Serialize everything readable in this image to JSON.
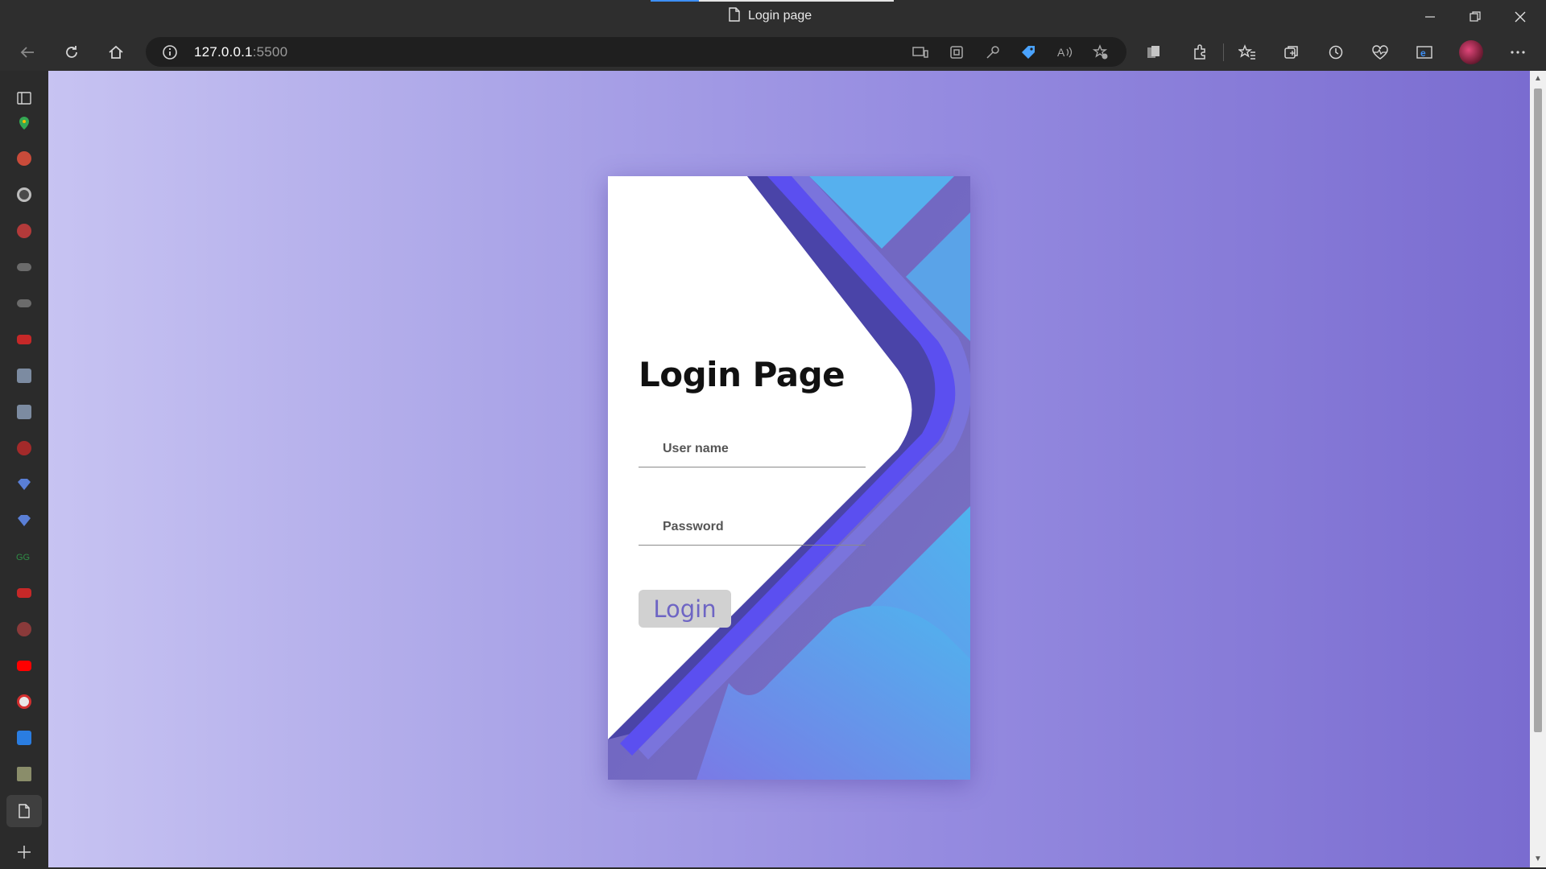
{
  "window": {
    "title": "Login page"
  },
  "toolbar": {
    "address_host": "127.0.0.1",
    "address_port": ":5500"
  },
  "page": {
    "heading": "Login Page",
    "username_placeholder": "User name",
    "password_placeholder": "Password",
    "login_label": "Login"
  },
  "colors": {
    "background_left": "#c7c3f2",
    "background_right": "#7a6cd0",
    "accent_stripe": "#5b4ff0",
    "button_text": "#6e65c4"
  },
  "icons": {
    "sidebar": [
      "tabs-icon",
      "maps-icon",
      "app-icon",
      "google-icon",
      "bank-icon",
      "chat-icon",
      "chat-icon",
      "youtube-icon",
      "app-icon",
      "app-icon",
      "app-icon",
      "diamond-icon",
      "diamond-icon",
      "geeks-icon",
      "youtube-icon",
      "app-icon",
      "youtube-icon",
      "app-icon",
      "app-icon",
      "image-icon",
      "page-icon",
      "add-icon"
    ]
  }
}
